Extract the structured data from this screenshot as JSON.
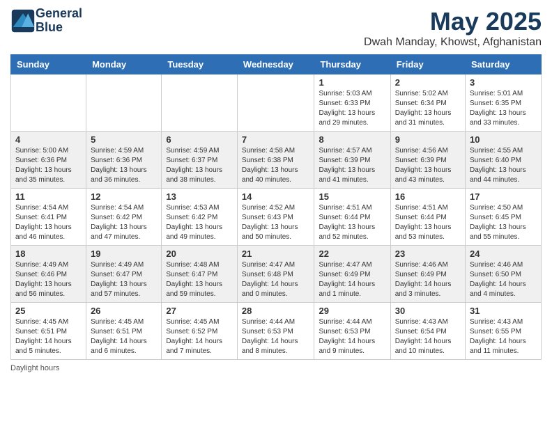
{
  "header": {
    "logo_line1": "General",
    "logo_line2": "Blue",
    "month_title": "May 2025",
    "location": "Dwah Manday, Khowst, Afghanistan"
  },
  "days_of_week": [
    "Sunday",
    "Monday",
    "Tuesday",
    "Wednesday",
    "Thursday",
    "Friday",
    "Saturday"
  ],
  "weeks": [
    [
      {
        "day": "",
        "info": ""
      },
      {
        "day": "",
        "info": ""
      },
      {
        "day": "",
        "info": ""
      },
      {
        "day": "",
        "info": ""
      },
      {
        "day": "1",
        "info": "Sunrise: 5:03 AM\nSunset: 6:33 PM\nDaylight: 13 hours\nand 29 minutes."
      },
      {
        "day": "2",
        "info": "Sunrise: 5:02 AM\nSunset: 6:34 PM\nDaylight: 13 hours\nand 31 minutes."
      },
      {
        "day": "3",
        "info": "Sunrise: 5:01 AM\nSunset: 6:35 PM\nDaylight: 13 hours\nand 33 minutes."
      }
    ],
    [
      {
        "day": "4",
        "info": "Sunrise: 5:00 AM\nSunset: 6:36 PM\nDaylight: 13 hours\nand 35 minutes."
      },
      {
        "day": "5",
        "info": "Sunrise: 4:59 AM\nSunset: 6:36 PM\nDaylight: 13 hours\nand 36 minutes."
      },
      {
        "day": "6",
        "info": "Sunrise: 4:59 AM\nSunset: 6:37 PM\nDaylight: 13 hours\nand 38 minutes."
      },
      {
        "day": "7",
        "info": "Sunrise: 4:58 AM\nSunset: 6:38 PM\nDaylight: 13 hours\nand 40 minutes."
      },
      {
        "day": "8",
        "info": "Sunrise: 4:57 AM\nSunset: 6:39 PM\nDaylight: 13 hours\nand 41 minutes."
      },
      {
        "day": "9",
        "info": "Sunrise: 4:56 AM\nSunset: 6:39 PM\nDaylight: 13 hours\nand 43 minutes."
      },
      {
        "day": "10",
        "info": "Sunrise: 4:55 AM\nSunset: 6:40 PM\nDaylight: 13 hours\nand 44 minutes."
      }
    ],
    [
      {
        "day": "11",
        "info": "Sunrise: 4:54 AM\nSunset: 6:41 PM\nDaylight: 13 hours\nand 46 minutes."
      },
      {
        "day": "12",
        "info": "Sunrise: 4:54 AM\nSunset: 6:42 PM\nDaylight: 13 hours\nand 47 minutes."
      },
      {
        "day": "13",
        "info": "Sunrise: 4:53 AM\nSunset: 6:42 PM\nDaylight: 13 hours\nand 49 minutes."
      },
      {
        "day": "14",
        "info": "Sunrise: 4:52 AM\nSunset: 6:43 PM\nDaylight: 13 hours\nand 50 minutes."
      },
      {
        "day": "15",
        "info": "Sunrise: 4:51 AM\nSunset: 6:44 PM\nDaylight: 13 hours\nand 52 minutes."
      },
      {
        "day": "16",
        "info": "Sunrise: 4:51 AM\nSunset: 6:44 PM\nDaylight: 13 hours\nand 53 minutes."
      },
      {
        "day": "17",
        "info": "Sunrise: 4:50 AM\nSunset: 6:45 PM\nDaylight: 13 hours\nand 55 minutes."
      }
    ],
    [
      {
        "day": "18",
        "info": "Sunrise: 4:49 AM\nSunset: 6:46 PM\nDaylight: 13 hours\nand 56 minutes."
      },
      {
        "day": "19",
        "info": "Sunrise: 4:49 AM\nSunset: 6:47 PM\nDaylight: 13 hours\nand 57 minutes."
      },
      {
        "day": "20",
        "info": "Sunrise: 4:48 AM\nSunset: 6:47 PM\nDaylight: 13 hours\nand 59 minutes."
      },
      {
        "day": "21",
        "info": "Sunrise: 4:47 AM\nSunset: 6:48 PM\nDaylight: 14 hours\nand 0 minutes."
      },
      {
        "day": "22",
        "info": "Sunrise: 4:47 AM\nSunset: 6:49 PM\nDaylight: 14 hours\nand 1 minute."
      },
      {
        "day": "23",
        "info": "Sunrise: 4:46 AM\nSunset: 6:49 PM\nDaylight: 14 hours\nand 3 minutes."
      },
      {
        "day": "24",
        "info": "Sunrise: 4:46 AM\nSunset: 6:50 PM\nDaylight: 14 hours\nand 4 minutes."
      }
    ],
    [
      {
        "day": "25",
        "info": "Sunrise: 4:45 AM\nSunset: 6:51 PM\nDaylight: 14 hours\nand 5 minutes."
      },
      {
        "day": "26",
        "info": "Sunrise: 4:45 AM\nSunset: 6:51 PM\nDaylight: 14 hours\nand 6 minutes."
      },
      {
        "day": "27",
        "info": "Sunrise: 4:45 AM\nSunset: 6:52 PM\nDaylight: 14 hours\nand 7 minutes."
      },
      {
        "day": "28",
        "info": "Sunrise: 4:44 AM\nSunset: 6:53 PM\nDaylight: 14 hours\nand 8 minutes."
      },
      {
        "day": "29",
        "info": "Sunrise: 4:44 AM\nSunset: 6:53 PM\nDaylight: 14 hours\nand 9 minutes."
      },
      {
        "day": "30",
        "info": "Sunrise: 4:43 AM\nSunset: 6:54 PM\nDaylight: 14 hours\nand 10 minutes."
      },
      {
        "day": "31",
        "info": "Sunrise: 4:43 AM\nSunset: 6:55 PM\nDaylight: 14 hours\nand 11 minutes."
      }
    ]
  ],
  "footer": "Daylight hours"
}
